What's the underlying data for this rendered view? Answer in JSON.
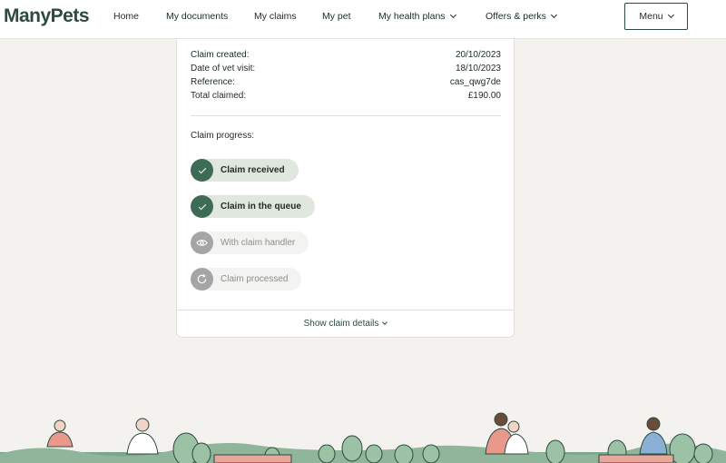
{
  "header": {
    "logo": "ManyPets",
    "nav": [
      {
        "label": "Home"
      },
      {
        "label": "My documents"
      },
      {
        "label": "My claims"
      },
      {
        "label": "My pet"
      },
      {
        "label": "My health plans"
      },
      {
        "label": "Offers & perks"
      }
    ],
    "menu_label": "Menu"
  },
  "claim": {
    "details": [
      {
        "label": "Claim created:",
        "value": "20/10/2023"
      },
      {
        "label": "Date of vet visit:",
        "value": "18/10/2023"
      },
      {
        "label": "Reference:",
        "value": "cas_qwg7de"
      },
      {
        "label": "Total claimed:",
        "value": "£190.00"
      }
    ],
    "progress_label": "Claim progress:",
    "steps": [
      {
        "label": "Claim received",
        "status": "complete",
        "icon": "check-icon"
      },
      {
        "label": "Claim in the queue",
        "status": "complete",
        "icon": "check-icon"
      },
      {
        "label": "With claim handler",
        "status": "pending",
        "icon": "eye-icon"
      },
      {
        "label": "Claim processed",
        "status": "pending",
        "icon": "refresh-icon"
      }
    ],
    "show_details_label": "Show claim details"
  },
  "colors": {
    "brand": "#2c4a3e",
    "step_done": "#3e6b55",
    "step_pending": "#a4a6a5",
    "background": "#f4f2ef"
  }
}
